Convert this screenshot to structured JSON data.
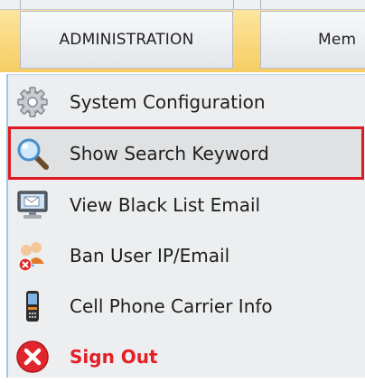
{
  "tabs": {
    "administration": "ADMINISTRATION",
    "members": "Mem"
  },
  "menu": [
    {
      "label": "System Configuration",
      "icon": "gear-icon"
    },
    {
      "label": "Show Search Keyword",
      "icon": "magnifier-icon",
      "highlighted": true
    },
    {
      "label": "View Black List Email",
      "icon": "monitor-email-icon"
    },
    {
      "label": "Ban User IP/Email",
      "icon": "users-ban-icon"
    },
    {
      "label": "Cell Phone Carrier Info",
      "icon": "cell-phone-icon"
    },
    {
      "label": "Sign Out",
      "icon": "sign-out-icon",
      "color": "#e51e26"
    }
  ],
  "colors": {
    "highlight_border": "#e01a24",
    "sign_out": "#e51e26",
    "topbar": "#f6cd62"
  }
}
